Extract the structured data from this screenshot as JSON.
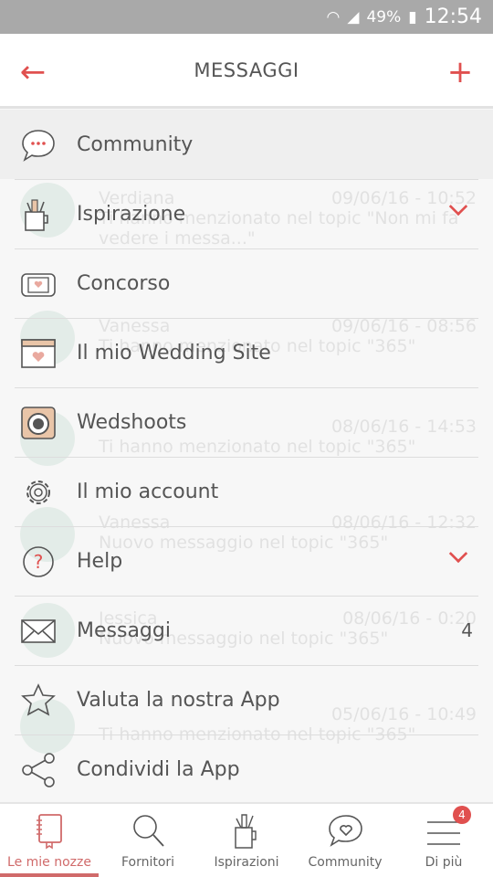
{
  "status": {
    "battery": "49%",
    "time": "12:54"
  },
  "header": {
    "title": "MESSAGGI",
    "back_icon": "arrow-left-icon",
    "add_icon": "plus-icon"
  },
  "background_messages": [
    {
      "name": "Verdiana",
      "date": "09/06/16 - 10:52",
      "text": "Ti hanno menzionato nel topic \"Non mi fa vedere i messa...\""
    },
    {
      "name": "Vanessa",
      "date": "09/06/16 - 08:56",
      "text": "Ti hanno menzionato nel topic \"365\""
    },
    {
      "name": "",
      "date": "08/06/16 - 14:53",
      "text": "Ti hanno menzionato nel topic \"365\""
    },
    {
      "name": "Vanessa",
      "date": "08/06/16 - 12:32",
      "text": "Nuovo messaggio nel topic \"365\""
    },
    {
      "name": "Jessica",
      "date": "08/06/16 - 0:20",
      "text": "Nuovo messaggio nel topic \"365\""
    },
    {
      "name": "",
      "date": "05/06/16 - 10:49",
      "text": "Ti hanno menzionato nel topic \"365\""
    }
  ],
  "menu": [
    {
      "label": "Community",
      "icon": "chat-bubble-icon"
    },
    {
      "label": "Ispirazione",
      "icon": "brush-cup-icon",
      "expandable": true
    },
    {
      "label": "Concorso",
      "icon": "ticket-icon"
    },
    {
      "label": "Il mio Wedding Site",
      "icon": "website-heart-icon"
    },
    {
      "label": "Wedshoots",
      "icon": "camera-icon"
    },
    {
      "label": "Il mio account",
      "icon": "gear-icon"
    },
    {
      "label": "Help",
      "icon": "help-icon",
      "expandable": true
    },
    {
      "label": "Messaggi",
      "icon": "envelope-icon",
      "count": "4"
    },
    {
      "label": "Valuta la nostra App",
      "icon": "star-icon"
    },
    {
      "label": "Condividi la App",
      "icon": "share-icon"
    }
  ],
  "nav": [
    {
      "label": "Le mie nozze",
      "icon": "notebook-icon",
      "active": true
    },
    {
      "label": "Fornitori",
      "icon": "search-icon"
    },
    {
      "label": "Ispirazioni",
      "icon": "brush-cup-icon"
    },
    {
      "label": "Community",
      "icon": "heart-chat-icon"
    },
    {
      "label": "Di più",
      "icon": "menu-icon",
      "badge": "4"
    }
  ],
  "colors": {
    "accent": "#e0504f",
    "active_tab": "#d06a6a"
  }
}
